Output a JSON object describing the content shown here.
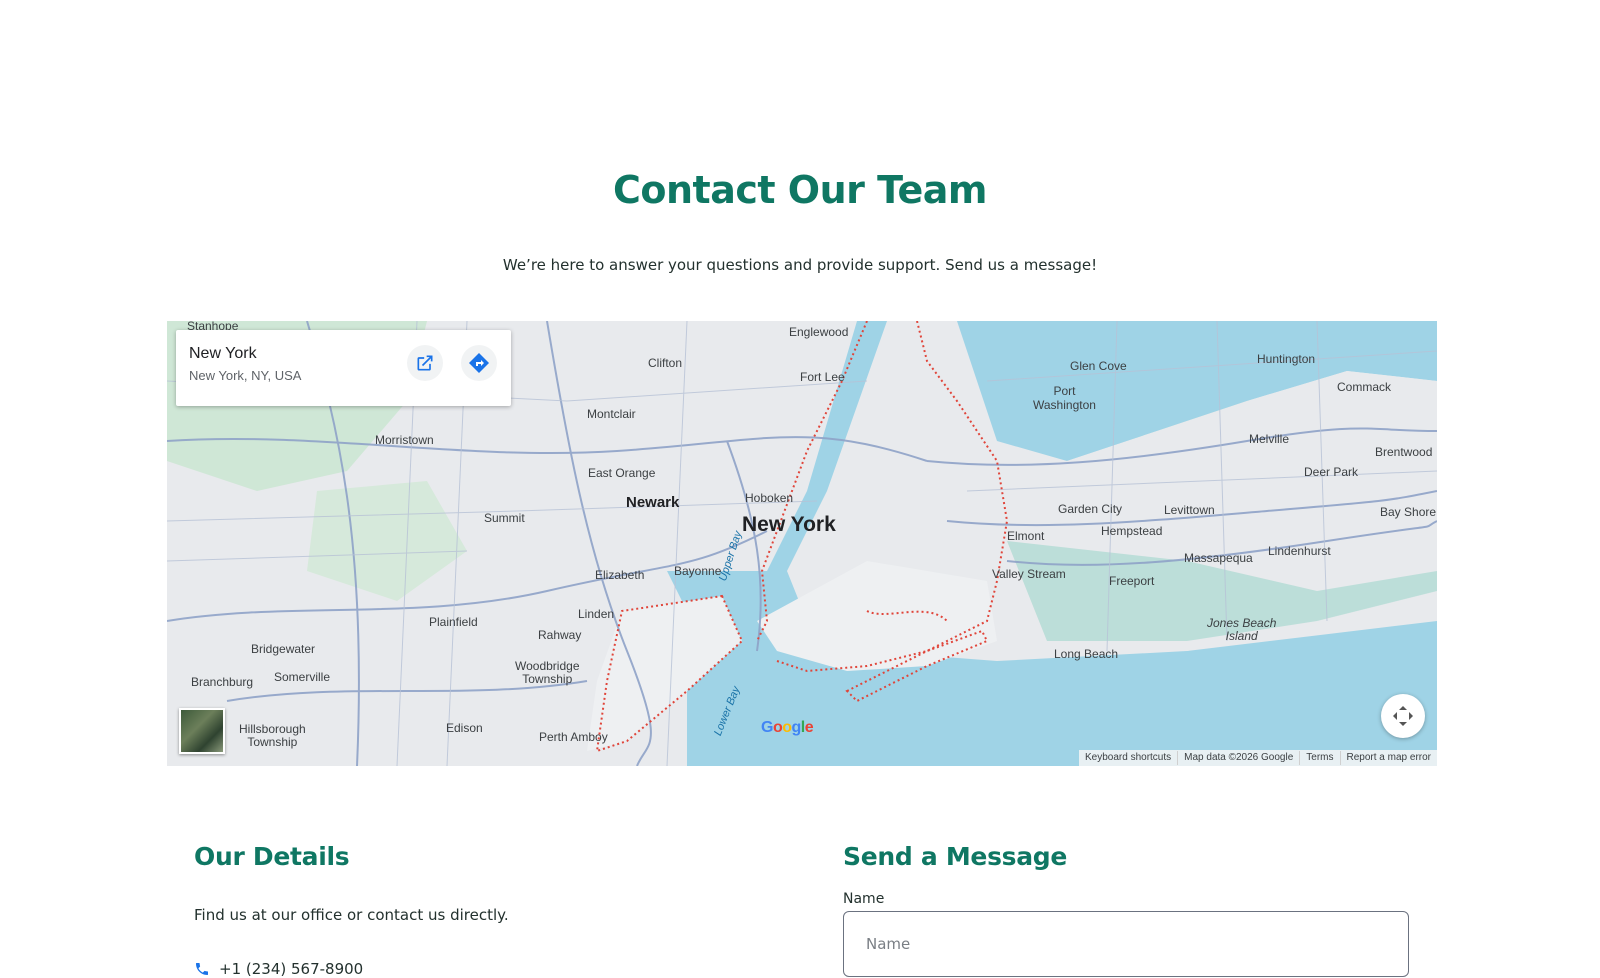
{
  "header": {
    "title": "Contact Our Team",
    "subtitle": "We’re here to answer your questions and provide support. Send us a message!"
  },
  "map": {
    "place_name": "New York",
    "place_address": "New York, NY, USA",
    "labels": {
      "main_city": "New York",
      "newark": "Newark",
      "stanhope": "Stanhope",
      "englewood": "Englewood",
      "clifton": "Clifton",
      "fort_lee": "Fort Lee",
      "glen_cove": "Glen Cove",
      "huntington": "Huntington",
      "commack": "Commack",
      "port_washington": "Port\nWashington",
      "montclair": "Montclair",
      "morristown": "Morristown",
      "melville": "Melville",
      "brentwood": "Brentwood",
      "east_orange": "East Orange",
      "deer_park": "Deer Park",
      "hoboken": "Hoboken",
      "garden_city": "Garden City",
      "levittown": "Levittown",
      "bay_shore": "Bay Shore",
      "summit": "Summit",
      "hempstead": "Hempstead",
      "elmont": "Elmont",
      "massapequa": "Massapequa",
      "lindenhurst": "Lindenhurst",
      "elizabeth": "Elizabeth",
      "bayonne": "Bayonne",
      "valley_stream": "Valley Stream",
      "freeport": "Freeport",
      "linden": "Linden",
      "plainfield": "Plainfield",
      "rahway": "Rahway",
      "jones_beach": "Jones Beach\nIsland",
      "bridgewater": "Bridgewater",
      "long_beach": "Long Beach",
      "somerville": "Somerville",
      "woodbridge": "Woodbridge\nTownship",
      "branchburg": "Branchburg",
      "hillsborough": "Hillsborough\nTownship",
      "edison": "Edison",
      "perth_amboy": "Perth Amboy",
      "upper_bay": "Upper Bay",
      "lower_bay": "Lower Bay"
    },
    "google_logo": "Google",
    "attribution": [
      "Keyboard shortcuts",
      "Map data ©2026 Google",
      "Terms",
      "Report a map error"
    ]
  },
  "details": {
    "title": "Our Details",
    "text": "Find us at our office or contact us directly.",
    "phone": "+1 (234) 567-8900"
  },
  "form": {
    "title": "Send a Message",
    "name_label": "Name",
    "name_placeholder": "Name",
    "name_value": ""
  },
  "colors": {
    "accent": "#0f7763",
    "map_water": "#9fd3e6",
    "map_land": "#e8eaed",
    "map_park": "#b9e0c4",
    "boundary": "#e0453a",
    "icon_blue": "#1a73e8"
  },
  "icons": [
    "open-external-icon",
    "directions-icon",
    "fullscreen-icon",
    "phone-icon"
  ]
}
